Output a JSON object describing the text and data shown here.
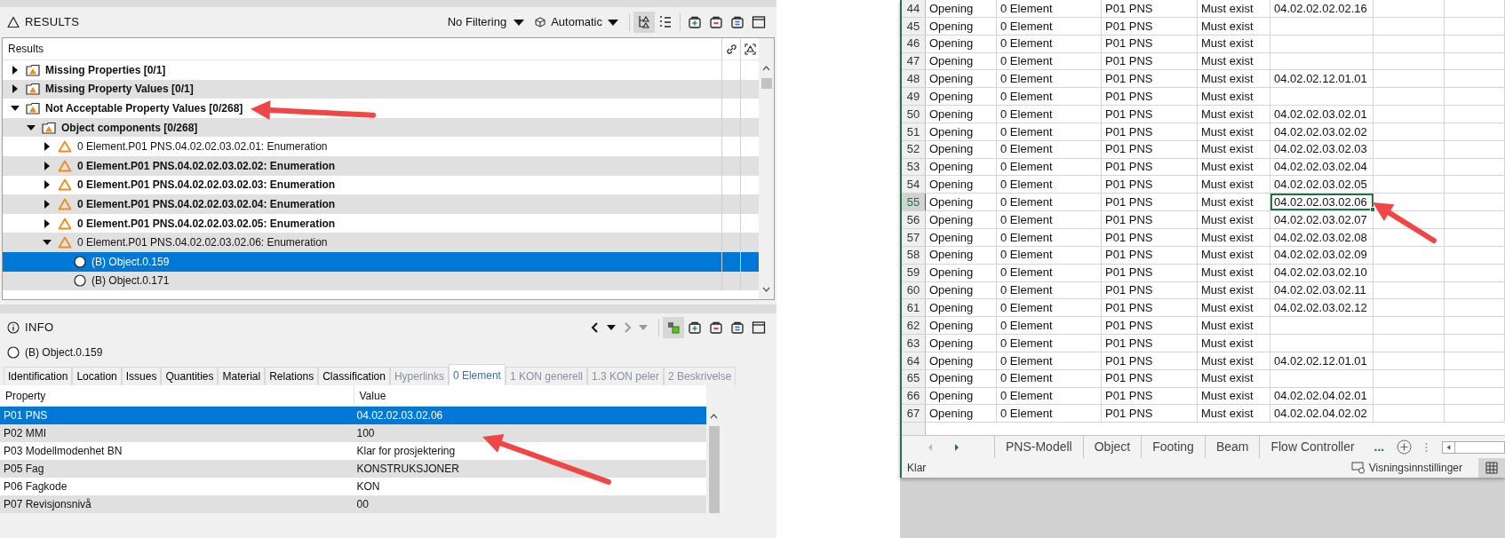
{
  "results_panel": {
    "title": "RESULTS",
    "filter": "No Filtering",
    "mode": "Automatic",
    "column": "Results",
    "tree": [
      {
        "kind": "folder",
        "label": "Missing Properties [0/1]",
        "bold": true,
        "expanded": false,
        "selected": false
      },
      {
        "kind": "folder",
        "label": "Missing Property Values [0/1]",
        "bold": true,
        "expanded": false,
        "selected": false
      },
      {
        "kind": "folder",
        "label": "Not Acceptable Property Values [0/268]",
        "bold": true,
        "expanded": true,
        "selected": false,
        "children": [
          {
            "kind": "folder",
            "label": "Object components [0/268]",
            "bold": true,
            "expanded": true,
            "selected": false,
            "children": [
              {
                "kind": "issue",
                "label": "0 Element.P01 PNS.04.02.02.03.02.01: Enumeration",
                "bold": false,
                "expanded": false,
                "selected": false
              },
              {
                "kind": "issue",
                "label": "0 Element.P01 PNS.04.02.02.03.02.02: Enumeration",
                "bold": true,
                "expanded": false,
                "selected": false
              },
              {
                "kind": "issue",
                "label": "0 Element.P01 PNS.04.02.02.03.02.03: Enumeration",
                "bold": true,
                "expanded": false,
                "selected": false
              },
              {
                "kind": "issue",
                "label": "0 Element.P01 PNS.04.02.02.03.02.04: Enumeration",
                "bold": true,
                "expanded": false,
                "selected": false
              },
              {
                "kind": "issue",
                "label": "0 Element.P01 PNS.04.02.02.03.02.05: Enumeration",
                "bold": true,
                "expanded": false,
                "selected": false
              },
              {
                "kind": "issue",
                "label": "0 Element.P01 PNS.04.02.02.03.02.06: Enumeration",
                "bold": false,
                "expanded": true,
                "selected": false,
                "children": [
                  {
                    "kind": "object",
                    "label": "(B) Object.0.159",
                    "bold": false,
                    "selected": true
                  },
                  {
                    "kind": "object",
                    "label": "(B) Object.0.171",
                    "bold": false,
                    "selected": false
                  }
                ]
              }
            ]
          }
        ]
      }
    ]
  },
  "info_panel": {
    "title": "INFO",
    "object": "(B) Object.0.159",
    "tabs": [
      {
        "label": "Identification",
        "selected": false,
        "disabled": false
      },
      {
        "label": "Location",
        "selected": false,
        "disabled": false
      },
      {
        "label": "Issues",
        "selected": false,
        "disabled": false
      },
      {
        "label": "Quantities",
        "selected": false,
        "disabled": false
      },
      {
        "label": "Material",
        "selected": false,
        "disabled": false
      },
      {
        "label": "Relations",
        "selected": false,
        "disabled": false
      },
      {
        "label": "Classification",
        "selected": false,
        "disabled": false
      },
      {
        "label": "Hyperlinks",
        "selected": false,
        "disabled": true
      },
      {
        "label": "0 Element",
        "selected": true,
        "disabled": false
      },
      {
        "label": "1 KON generell",
        "selected": false,
        "disabled": true
      },
      {
        "label": "1.3 KON peler",
        "selected": false,
        "disabled": true
      },
      {
        "label": "2 Beskrivelse",
        "selected": false,
        "disabled": true
      }
    ],
    "columns": [
      "Property",
      "Value"
    ],
    "rows": [
      {
        "property": "P01 PNS",
        "value": "04.02.02.03.02.06",
        "selected": true
      },
      {
        "property": "P02 MMI",
        "value": "100",
        "selected": false
      },
      {
        "property": "P03 Modellmodenhet BN",
        "value": "Klar for prosjektering",
        "selected": false
      },
      {
        "property": "P05 Fag",
        "value": "KONSTRUKSJONER",
        "selected": false
      },
      {
        "property": "P06 Fagkode",
        "value": "KON",
        "selected": false
      },
      {
        "property": "P07 Revisjonsnivå",
        "value": "00",
        "selected": false
      }
    ]
  },
  "spreadsheet": {
    "rows": [
      {
        "number": "44",
        "cells": [
          "Opening",
          "0 Element",
          "P01 PNS",
          "Must exist",
          "04.02.02.02.02.16"
        ],
        "selected": false
      },
      {
        "number": "45",
        "cells": [
          "Opening",
          "0 Element",
          "P01 PNS",
          "Must exist"
        ],
        "selected": false
      },
      {
        "number": "46",
        "cells": [
          "Opening",
          "0 Element",
          "P01 PNS",
          "Must exist"
        ],
        "selected": false
      },
      {
        "number": "47",
        "cells": [
          "Opening",
          "0 Element",
          "P01 PNS",
          "Must exist"
        ],
        "selected": false
      },
      {
        "number": "48",
        "cells": [
          "Opening",
          "0 Element",
          "P01 PNS",
          "Must exist",
          "04.02.02.12.01.01"
        ],
        "selected": false
      },
      {
        "number": "49",
        "cells": [
          "Opening",
          "0 Element",
          "P01 PNS",
          "Must exist"
        ],
        "selected": false
      },
      {
        "number": "50",
        "cells": [
          "Opening",
          "0 Element",
          "P01 PNS",
          "Must exist",
          "04.02.02.03.02.01"
        ],
        "selected": false
      },
      {
        "number": "51",
        "cells": [
          "Opening",
          "0 Element",
          "P01 PNS",
          "Must exist",
          "04.02.02.03.02.02"
        ],
        "selected": false
      },
      {
        "number": "52",
        "cells": [
          "Opening",
          "0 Element",
          "P01 PNS",
          "Must exist",
          "04.02.02.03.02.03"
        ],
        "selected": false
      },
      {
        "number": "53",
        "cells": [
          "Opening",
          "0 Element",
          "P01 PNS",
          "Must exist",
          "04.02.02.03.02.04"
        ],
        "selected": false
      },
      {
        "number": "54",
        "cells": [
          "Opening",
          "0 Element",
          "P01 PNS",
          "Must exist",
          "04.02.02.03.02.05"
        ],
        "selected": false
      },
      {
        "number": "55",
        "cells": [
          "Opening",
          "0 Element",
          "P01 PNS",
          "Must exist",
          "04.02.02.03.02.06"
        ],
        "selected": true
      },
      {
        "number": "56",
        "cells": [
          "Opening",
          "0 Element",
          "P01 PNS",
          "Must exist",
          "04.02.02.03.02.07"
        ],
        "selected": false
      },
      {
        "number": "57",
        "cells": [
          "Opening",
          "0 Element",
          "P01 PNS",
          "Must exist",
          "04.02.02.03.02.08"
        ],
        "selected": false
      },
      {
        "number": "58",
        "cells": [
          "Opening",
          "0 Element",
          "P01 PNS",
          "Must exist",
          "04.02.02.03.02.09"
        ],
        "selected": false
      },
      {
        "number": "59",
        "cells": [
          "Opening",
          "0 Element",
          "P01 PNS",
          "Must exist",
          "04.02.02.03.02.10"
        ],
        "selected": false
      },
      {
        "number": "60",
        "cells": [
          "Opening",
          "0 Element",
          "P01 PNS",
          "Must exist",
          "04.02.02.03.02.11"
        ],
        "selected": false
      },
      {
        "number": "61",
        "cells": [
          "Opening",
          "0 Element",
          "P01 PNS",
          "Must exist",
          "04.02.02.03.02.12"
        ],
        "selected": false
      },
      {
        "number": "62",
        "cells": [
          "Opening",
          "0 Element",
          "P01 PNS",
          "Must exist"
        ],
        "selected": false
      },
      {
        "number": "63",
        "cells": [
          "Opening",
          "0 Element",
          "P01 PNS",
          "Must exist"
        ],
        "selected": false
      },
      {
        "number": "64",
        "cells": [
          "Opening",
          "0 Element",
          "P01 PNS",
          "Must exist",
          "04.02.02.12.01.01"
        ],
        "selected": false
      },
      {
        "number": "65",
        "cells": [
          "Opening",
          "0 Element",
          "P01 PNS",
          "Must exist"
        ],
        "selected": false
      },
      {
        "number": "66",
        "cells": [
          "Opening",
          "0 Element",
          "P01 PNS",
          "Must exist",
          "04.02.02.04.02.01"
        ],
        "selected": false
      },
      {
        "number": "67",
        "cells": [
          "Opening",
          "0 Element",
          "P01 PNS",
          "Must exist",
          "04.02.02.04.02.02"
        ],
        "selected": false
      }
    ],
    "sheet_tabs": [
      "PNS-Modell",
      "Object",
      "Footing",
      "Beam",
      "Flow Controller"
    ],
    "more_tabs": "...",
    "status": "Klar",
    "view_settings": "Visningsinnstillinger"
  }
}
